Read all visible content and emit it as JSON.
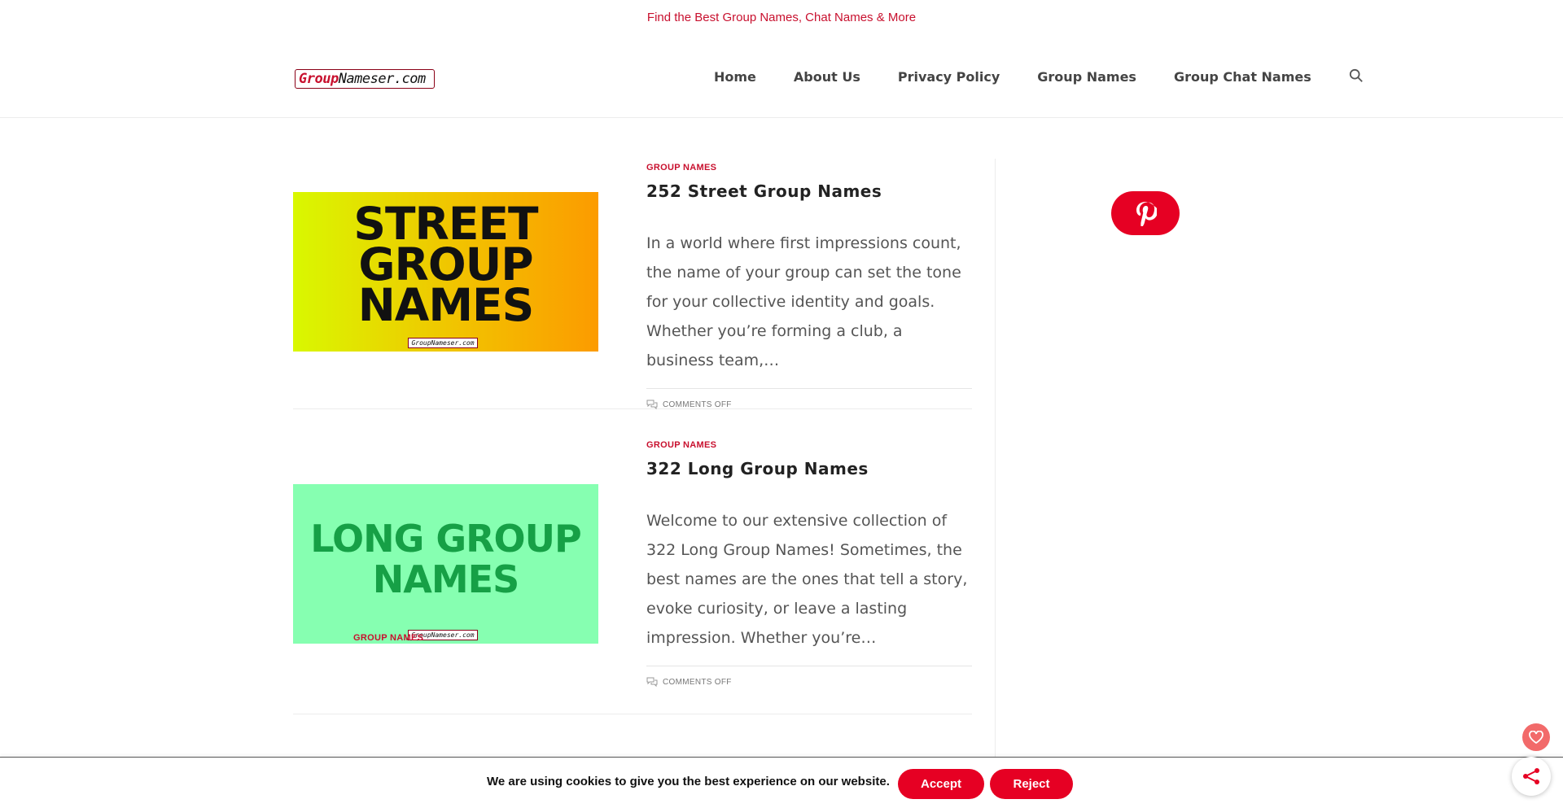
{
  "topbar": {
    "tagline": "Find the Best Group Names, Chat Names & More"
  },
  "header": {
    "logo": {
      "part1": "Group",
      "part2": "Nameser.com"
    },
    "nav": [
      {
        "label": "Home"
      },
      {
        "label": "About Us"
      },
      {
        "label": "Privacy Policy"
      },
      {
        "label": "Group Names"
      },
      {
        "label": "Group Chat Names"
      }
    ],
    "search_icon": "search-icon"
  },
  "posts": [
    {
      "category": "GROUP NAMES",
      "title": "252 Street Group Names",
      "excerpt": "In a world where first impressions count, the name of your group can set the tone for your collective identity and goals. Whether you’re forming a club, a business team,…",
      "meta": "COMMENTS OFF",
      "thumb": {
        "text": "STREET GROUP NAMES",
        "watermark": "GroupNameser.com",
        "colors": [
          "#d9f800",
          "#fc9b00"
        ]
      }
    },
    {
      "category": "GROUP NAMES",
      "title": "322 Long Group Names",
      "excerpt": "Welcome to our extensive collection of 322 Long Group Names! Sometimes, the best names are the ones that tell a story, evoke curiosity, or leave a lasting impression. Whether you’re…",
      "meta": "COMMENTS OFF",
      "thumb": {
        "text": "LONG GROUP NAMES",
        "watermark": "GroupNameser.com",
        "colors": [
          "#86ffb1",
          "#16a046"
        ]
      }
    },
    {
      "category": "GROUP NAMES"
    }
  ],
  "sidebar": {
    "pinterest_icon": "pinterest-icon",
    "accent": "#e60023"
  },
  "cookie": {
    "message": "We are using cookies to give you the best experience on our website.",
    "accept": "Accept",
    "reject": "Reject"
  },
  "floating": {
    "heart_icon": "heart-icon",
    "share_icon": "share-icon"
  }
}
